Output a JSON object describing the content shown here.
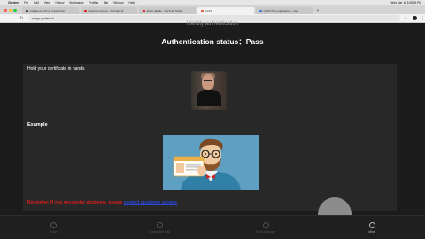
{
  "menubar": {
    "apple": "",
    "items": [
      "Chrome",
      "File",
      "Edit",
      "View",
      "History",
      "Bookmarks",
      "Profiles",
      "Tab",
      "Window",
      "Help"
    ],
    "clock": "Wed Mar 16 5:38:09 PM"
  },
  "tabs": [
    {
      "title": "Intelligence Prime Capital Ser"
    },
    {
      "title": "Channel content - YouTube St"
    },
    {
      "title": "Video details - YouTube Studio"
    },
    {
      "title": "CCFX"
    },
    {
      "title": "CCFX Pre-registration — sleu"
    }
  ],
  "toolbar": {
    "url": "adapp.cpatex.ch"
  },
  "page": {
    "subheading": "Identity authentication",
    "status_title": "Authentication status：Pass",
    "hold_text": "Hold your certificate in hands",
    "example_label": "Example",
    "reminder_prefix": "Reminder: If you encounter problems, please ",
    "reminder_link": "contact customer service"
  },
  "bottom_nav": [
    {
      "label": "Home"
    },
    {
      "label": "Transaction Hall"
    },
    {
      "label": "Stock Manager"
    },
    {
      "label": "Mine"
    }
  ],
  "colors": {
    "reminder": "#d81e1e",
    "link": "#2a47d8",
    "panel": "#282828",
    "background": "#1c1c1c"
  }
}
